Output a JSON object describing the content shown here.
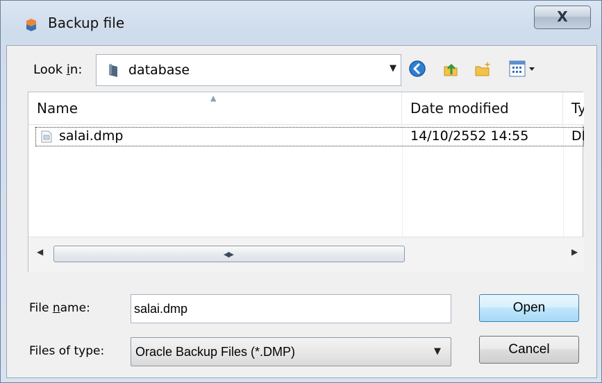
{
  "window": {
    "title": "Backup file",
    "close_label": "X"
  },
  "toolbar": {
    "lookin_prefix": "Look ",
    "lookin_access": "i",
    "lookin_suffix": "n:",
    "lookin_value": "database",
    "icons": [
      "back-icon",
      "up-folder-icon",
      "new-folder-icon",
      "view-menu-icon"
    ]
  },
  "list": {
    "columns": [
      "Name",
      "Date modified",
      "Ty"
    ],
    "rows": [
      {
        "name": "salai.dmp",
        "date_modified": "14/10/2552 14:55",
        "type": "DI"
      }
    ]
  },
  "form": {
    "filename_prefix": "File ",
    "filename_access": "n",
    "filename_suffix": "ame:",
    "filename_value": "salai.dmp",
    "filetype_label": "Files of type:",
    "filetype_value": "Oracle Backup Files (*.DMP)"
  },
  "buttons": {
    "open": "Open",
    "cancel": "Cancel"
  },
  "colors": {
    "default_button": "#bee6fd",
    "window_frame": "#cfdcec"
  }
}
